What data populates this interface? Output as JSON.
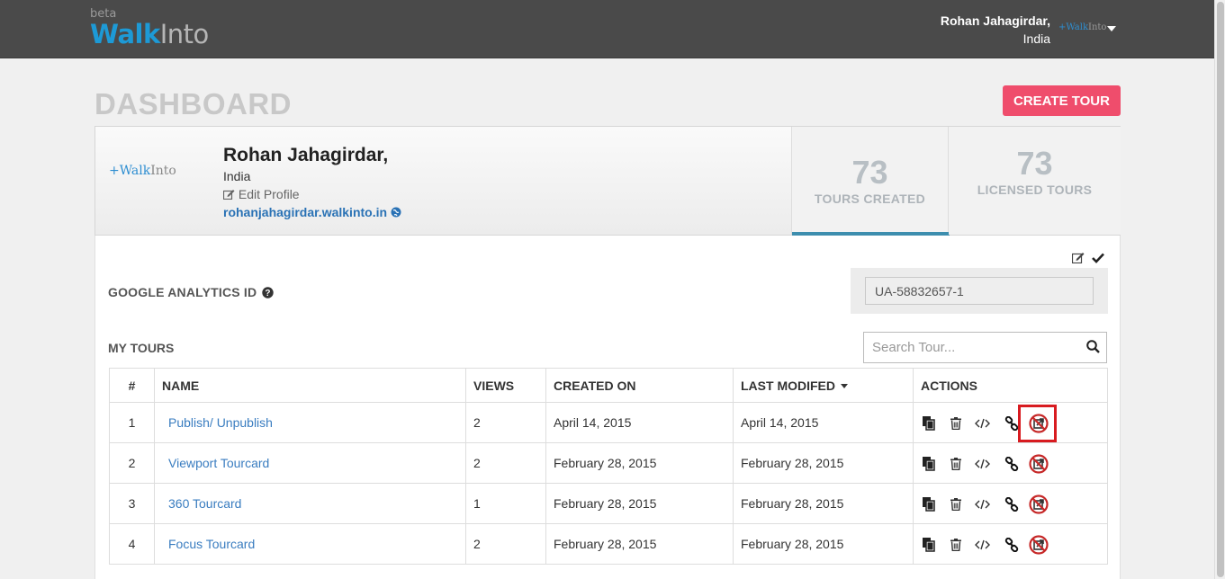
{
  "header": {
    "logo_beta": "beta",
    "logo_walk": "Walk",
    "logo_into": "Into",
    "user_name": "Rohan Jahagirdar,",
    "user_country": "India",
    "mini_logo_walk": "+Walk",
    "mini_logo_into": "Into"
  },
  "page": {
    "title": "DASHBOARD",
    "create_button": "CREATE TOUR"
  },
  "profile": {
    "logo_walk": "+Walk",
    "logo_into": "Into",
    "name": "Rohan Jahagirdar,",
    "country": "India",
    "edit_label": "Edit Profile",
    "site_link": "rohanjahagirdar.walkinto.in"
  },
  "stats": {
    "tours_created_value": "73",
    "tours_created_label": "TOURS CREATED",
    "licensed_value": "73",
    "licensed_label": "LICENSED TOURS"
  },
  "analytics": {
    "label": "GOOGLE ANALYTICS ID",
    "value": "UA-58832657-1"
  },
  "tours": {
    "section_label": "MY TOURS",
    "search_placeholder": "Search Tour...",
    "columns": [
      "#",
      "NAME",
      "VIEWS",
      "CREATED ON",
      "LAST MODIFED",
      "ACTIONS"
    ],
    "rows": [
      {
        "index": "1",
        "name": "Publish/ Unpublish",
        "views": "2",
        "created": "April 14, 2015",
        "modified": "April 14, 2015"
      },
      {
        "index": "2",
        "name": "Viewport Tourcard",
        "views": "2",
        "created": "February 28, 2015",
        "modified": "February 28, 2015"
      },
      {
        "index": "3",
        "name": "360 Tourcard",
        "views": "1",
        "created": "February 28, 2015",
        "modified": "February 28, 2015"
      },
      {
        "index": "4",
        "name": "Focus Tourcard",
        "views": "2",
        "created": "February 28, 2015",
        "modified": "February 28, 2015"
      }
    ]
  },
  "colors": {
    "accent": "#ef4d6c",
    "link": "#3a7dc0",
    "topbar": "#4a4a4a",
    "highlight": "#d81b20"
  }
}
